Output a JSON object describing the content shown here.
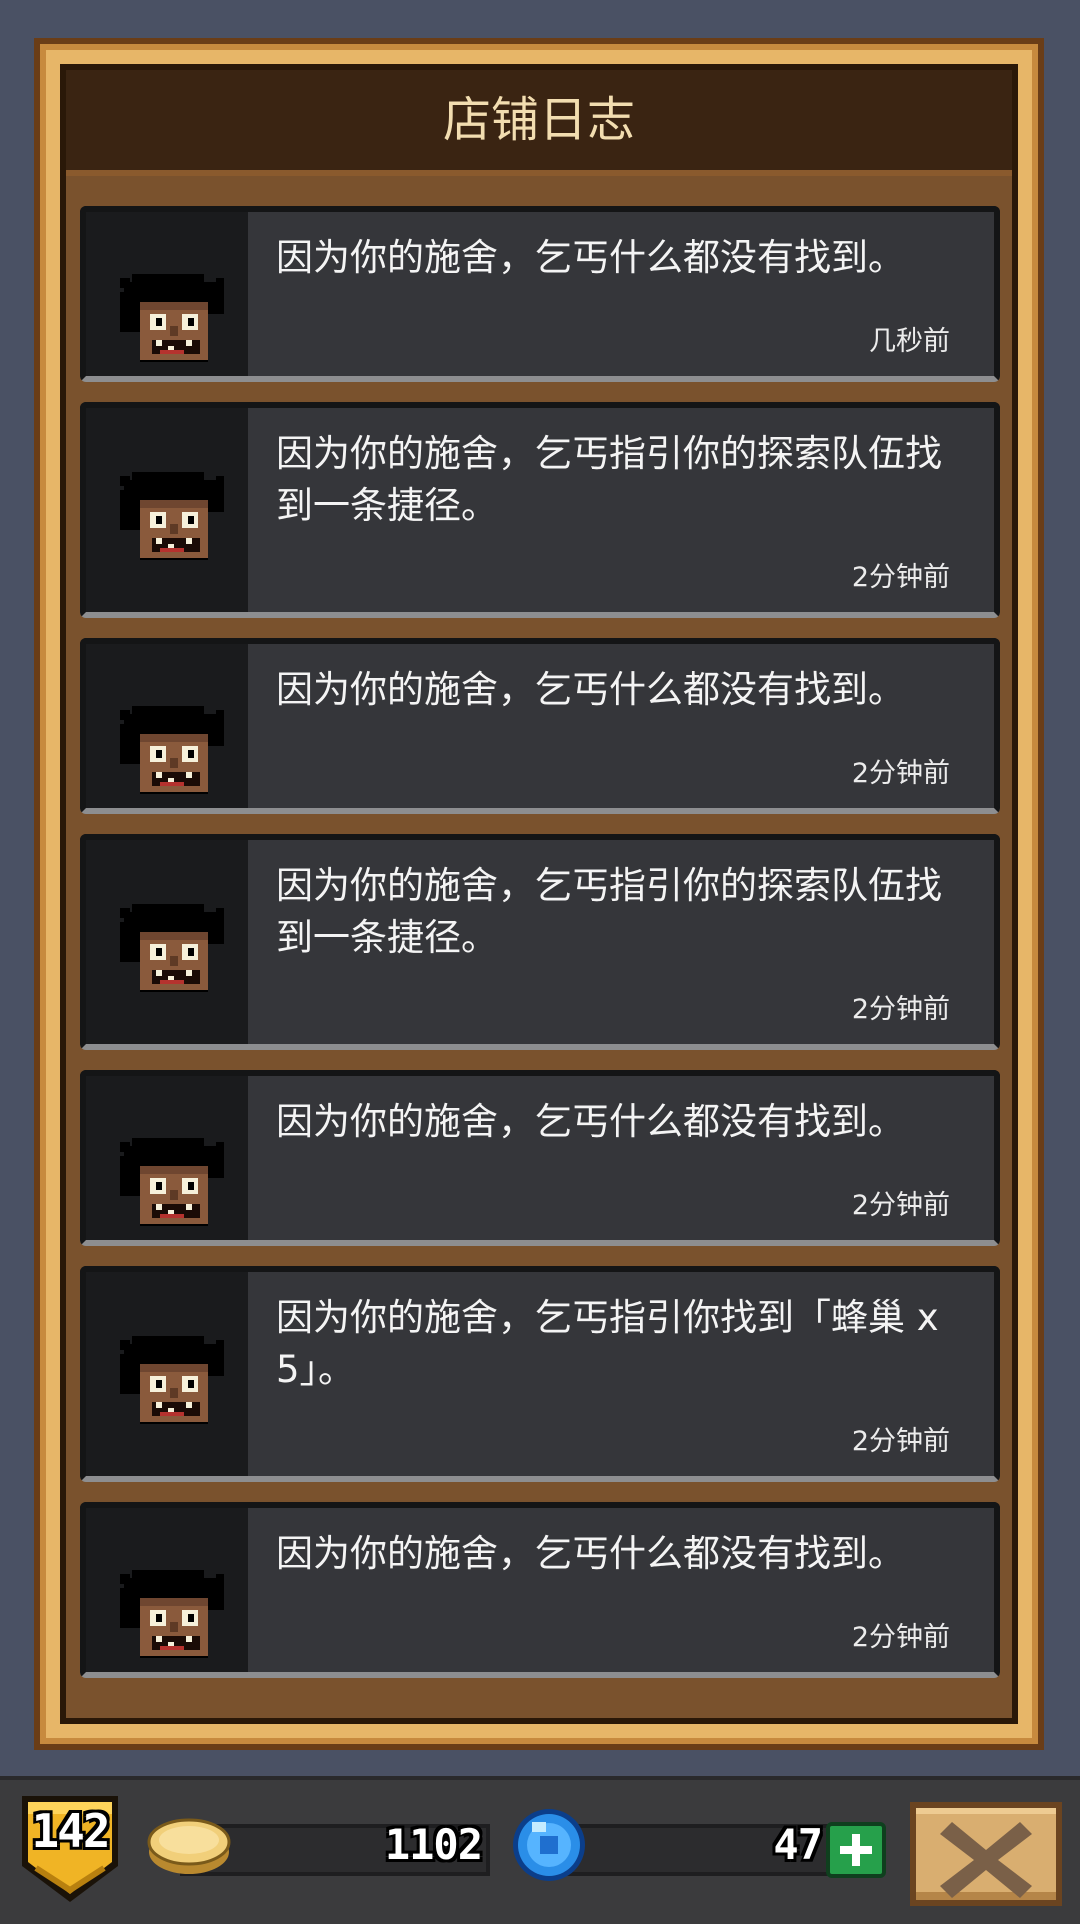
{
  "header": {
    "title": "店铺日志"
  },
  "log_entries": [
    {
      "message": "因为你的施舍，乞丐什么都没有找到。",
      "time": "几秒前"
    },
    {
      "message": "因为你的施舍，乞丐指引你的探索队伍找到一条捷径。",
      "time": "2分钟前"
    },
    {
      "message": "因为你的施舍，乞丐什么都没有找到。",
      "time": "2分钟前"
    },
    {
      "message": "因为你的施舍，乞丐指引你的探索队伍找到一条捷径。",
      "time": "2分钟前"
    },
    {
      "message": "因为你的施舍，乞丐什么都没有找到。",
      "time": "2分钟前"
    },
    {
      "message": "因为你的施舍，乞丐指引你找到「蜂巢 x 5」。",
      "time": "2分钟前"
    },
    {
      "message": "因为你的施舍，乞丐什么都没有找到。",
      "time": "2分钟前"
    }
  ],
  "status_bar": {
    "level": "142",
    "gold": "1102",
    "gems": "47"
  },
  "colors": {
    "panel_frame": "#e7b668",
    "panel_body": "#7a522d",
    "entry_bg": "#35363a",
    "gem_add": "#26a04b"
  },
  "icons": {
    "avatar": "beggar-avatar-icon",
    "gold": "gold-coin-icon",
    "gems": "blue-gem-icon",
    "add": "plus-icon",
    "close": "close-x-icon",
    "level": "level-shield-icon"
  }
}
